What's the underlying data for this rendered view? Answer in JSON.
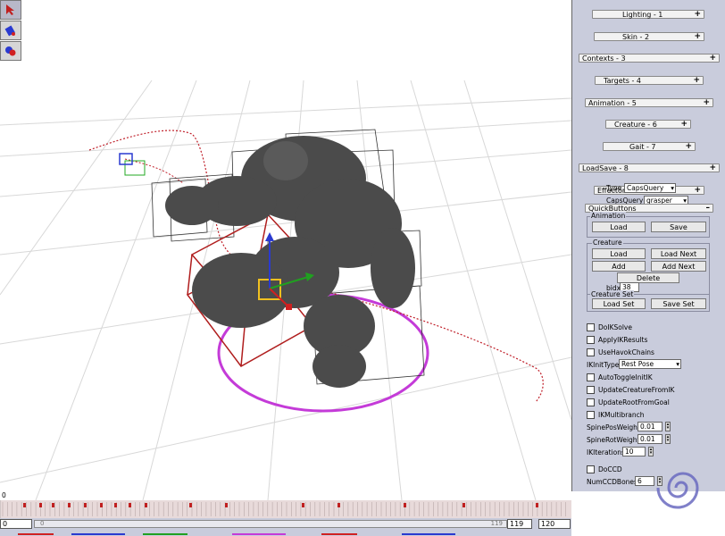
{
  "rollouts": [
    {
      "label": "Lighting - 1"
    },
    {
      "label": "Skin - 2"
    },
    {
      "label": "Contexts - 3"
    },
    {
      "label": "Targets - 4"
    },
    {
      "label": "Animation - 5"
    },
    {
      "label": "Creature - 6"
    },
    {
      "label": "Gait - 7"
    },
    {
      "label": "LoadSave - 8"
    },
    {
      "label": "Effector"
    }
  ],
  "type_row": {
    "label": "Type",
    "value": "CapsQuery"
  },
  "capsquery_row": {
    "label": "CapsQuery",
    "value": "grasper"
  },
  "quickbuttons": {
    "title": "QuickButtons",
    "collapse": "–",
    "animation": {
      "title": "Animation",
      "load": "Load",
      "save": "Save"
    },
    "creature": {
      "title": "Creature",
      "load": "Load",
      "load_next": "Load Next",
      "add": "Add",
      "add_next": "Add Next",
      "delete": "Delete",
      "bidx_label": "bidx",
      "bidx_value": "38"
    },
    "creature_set": {
      "title": "Creature Set",
      "load_set": "Load Set",
      "save_set": "Save Set"
    }
  },
  "options": {
    "do_ik_solve": "DoIKSolve",
    "apply_ik_results": "ApplyIKResults",
    "use_havok_chains": "UseHavokChains",
    "ik_init_type_label": "IKInitType",
    "ik_init_type_value": "Rest Pose",
    "auto_toggle_init_ik": "AutoToggleInitIK",
    "update_creature_from_ik": "UpdateCreatureFromIK",
    "update_root_from_goal": "UpdateRootFromGoal",
    "ik_multibranch": "IKMultibranch",
    "spine_pos_weight_label": "SpinePosWeight",
    "spine_pos_weight_value": "0.01",
    "spine_rot_weight_label": "SpineRotWeight",
    "spine_rot_weight_value": "0.01",
    "ik_iterations_label": "IKIterations",
    "ik_iterations_value": "10",
    "do_ccd": "DoCCD",
    "num_ccd_bones_label": "NumCCDBones",
    "num_ccd_bones_value": "6"
  },
  "timeline": {
    "frame_top": "0",
    "start_value": "0",
    "ruler_start": "0",
    "ruler_end": "119",
    "current_frame": "119",
    "end_frame": "120"
  },
  "colors": {
    "panel": "#c9ccdc",
    "path": "#c0202a",
    "circle": "#c43bd8",
    "accent": "#2a3ad0"
  },
  "icons": [
    "select-arrow-icon",
    "paint-bucket-icon",
    "paint-tool-icon",
    "logo-swirl-icon"
  ]
}
